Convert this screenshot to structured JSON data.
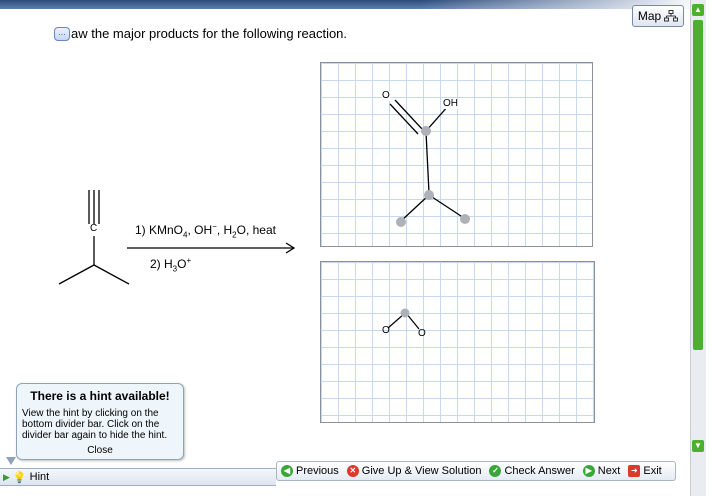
{
  "question": {
    "text": "aw the major products for the following reaction."
  },
  "map_button": {
    "label": "Map"
  },
  "reaction": {
    "carbon_label": "C",
    "step1_label": "1) KMnO",
    "step1_sub": "4",
    "step1_rest": ", OH",
    "step1_sup": "−",
    "step1_water": ", H",
    "step1_water_sub": "2",
    "step1_tail": "O, heat",
    "step2_label": "2) H",
    "step2_sub": "3",
    "step2_o": "O",
    "step2_sup": "+"
  },
  "product1": {
    "o_label": "O",
    "oh_label": "OH"
  },
  "product2": {
    "o_left": "O",
    "o_right": "O"
  },
  "hint_popup": {
    "title": "There is a hint available!",
    "body": "View the hint by clicking on the bottom divider bar. Click on the divider bar again to hide the hint.",
    "close": "Close"
  },
  "hint_bar": {
    "label": "Hint"
  },
  "nav": {
    "previous": "Previous",
    "give_up": "Give Up & View Solution",
    "check": "Check Answer",
    "next": "Next",
    "exit": "Exit"
  },
  "icons": {
    "previous": "arrow-left-circle-icon",
    "give_up": "x-circle-icon",
    "check": "check-circle-icon",
    "next": "arrow-right-circle-icon",
    "exit": "exit-icon",
    "hint": "lightbulb-icon",
    "map": "map-icon",
    "question": "chat-bubble-icon"
  },
  "colors": {
    "accent_green": "#3aa63a",
    "accent_red": "#d93a2a",
    "grid_line": "#c6d9ee",
    "title_strip": "#2b4a7a"
  }
}
